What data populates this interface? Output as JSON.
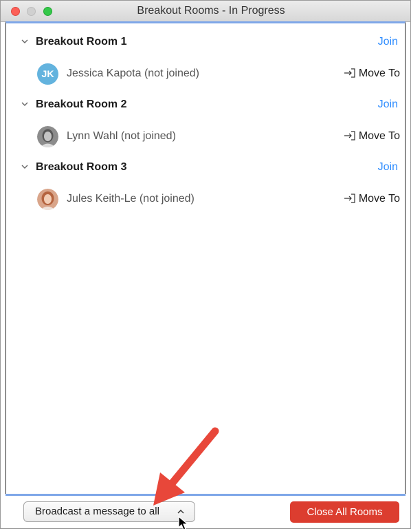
{
  "window": {
    "title": "Breakout Rooms - In Progress"
  },
  "rooms": [
    {
      "name": "Breakout Room 1",
      "join_label": "Join",
      "participant": {
        "initials": "JK",
        "name": "Jessica Kapota (not joined)",
        "move_label": "Move To"
      }
    },
    {
      "name": "Breakout Room 2",
      "join_label": "Join",
      "participant": {
        "name": "Lynn Wahl (not joined)",
        "move_label": "Move To"
      }
    },
    {
      "name": "Breakout Room 3",
      "join_label": "Join",
      "participant": {
        "name": "Jules Keith-Le (not joined)",
        "move_label": "Move To"
      }
    }
  ],
  "footer": {
    "broadcast_label": "Broadcast a message to all",
    "close_all_label": "Close All Rooms"
  },
  "colors": {
    "accent_link": "#2d8cff",
    "close_button": "#dc3d2f",
    "annotation_arrow": "#e8473a",
    "divider": "#7fa7e8"
  },
  "icons": {
    "room_toggle": "chevron-down-icon",
    "move": "move-to-icon",
    "broadcast_caret": "caret-up-icon",
    "pointer": "mouse-cursor-icon",
    "annotation": "red-arrow-annotation"
  }
}
